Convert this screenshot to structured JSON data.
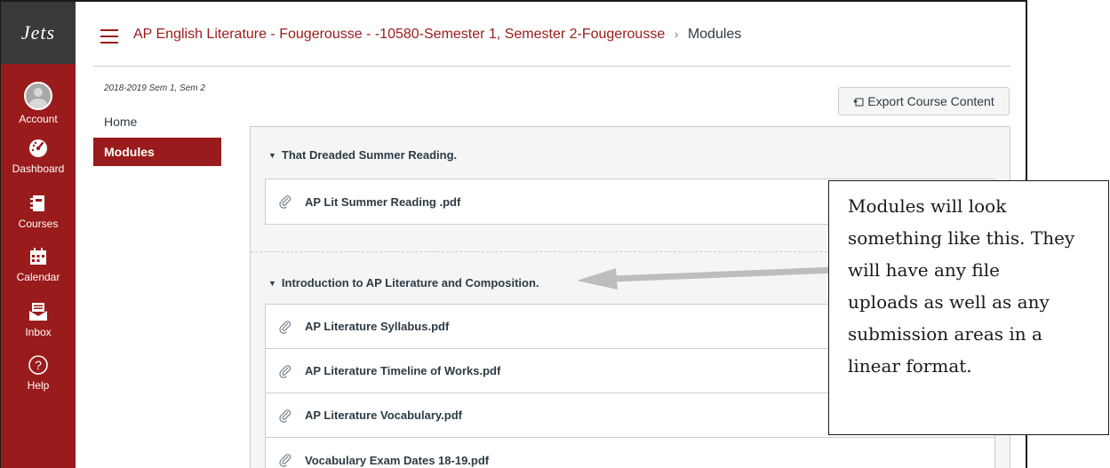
{
  "global_nav": {
    "logo_text": "Jets",
    "items": [
      {
        "label": "Account",
        "icon": "account-avatar"
      },
      {
        "label": "Dashboard",
        "icon": "dashboard-gauge-icon"
      },
      {
        "label": "Courses",
        "icon": "courses-book-icon"
      },
      {
        "label": "Calendar",
        "icon": "calendar-icon"
      },
      {
        "label": "Inbox",
        "icon": "inbox-icon"
      },
      {
        "label": "Help",
        "icon": "help-icon"
      }
    ],
    "active_item": "Courses",
    "colors": {
      "nav_bg": "#9a1b1b",
      "logo_bg": "#393939"
    }
  },
  "header": {
    "course_title": "AP English Literature - Fougerousse - -10580-Semester 1, Semester 2-Fougerousse",
    "separator": "›",
    "current_page": "Modules"
  },
  "course_nav": {
    "term": "2018-2019 Sem 1, Sem 2",
    "items": [
      {
        "label": "Home",
        "active": false
      },
      {
        "label": "Modules",
        "active": true
      }
    ]
  },
  "toolbar": {
    "export_label": "Export Course Content"
  },
  "modules": [
    {
      "title": "That Dreaded Summer Reading.",
      "items": [
        "AP Lit Summer Reading .pdf"
      ]
    },
    {
      "title": "Introduction to AP Literature and Composition.",
      "items": [
        "AP Literature Syllabus.pdf",
        "AP Literature Timeline of Works.pdf",
        "AP Literature Vocabulary.pdf",
        "Vocabulary Exam Dates 18-19.pdf"
      ]
    }
  ],
  "annotation": {
    "lines": [
      "Modules will look",
      "something like this. They",
      "will have any file",
      "uploads as well as any",
      "submission areas in a",
      "linear format."
    ]
  },
  "colors": {
    "brand": "#9a1b1b",
    "text": "#2d3b45",
    "border": "#c7cdd1",
    "module_bg": "#f5f5f5"
  }
}
